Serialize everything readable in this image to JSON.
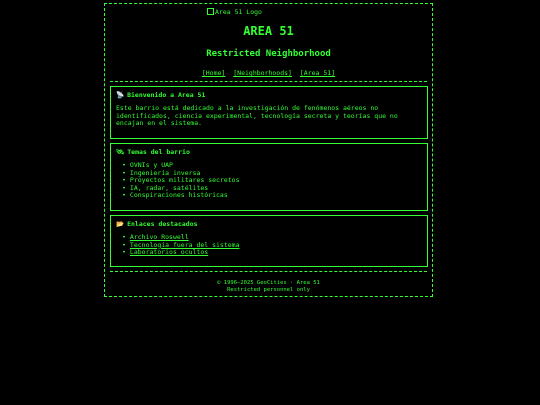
{
  "header": {
    "logo_alt": "Area 51 Logo",
    "title": "AREA 51",
    "subtitle": "Restricted Neighborhood"
  },
  "nav": {
    "links": [
      "[Home]",
      "[Neighborhoods]",
      "[Area 51]"
    ]
  },
  "welcome": {
    "icon": "satellite-dish-icon",
    "glyph": "📡",
    "heading": "Bienvenido a Area 51",
    "text": "Este barrio está dedicado a la investigación de fenómenos aéreos no identificados, ciencia experimental, tecnología secreta y teorías que no encajan en el sistema."
  },
  "topics": {
    "icon": "satellite-icon",
    "glyph": "🛰",
    "heading": "Temas del barrio",
    "items": [
      "OVNIs y UAP",
      "Ingeniería inversa",
      "Proyectos militares secretos",
      "IA, radar, satélites",
      "Conspiraciones históricas"
    ]
  },
  "links": {
    "icon": "open-folder-icon",
    "glyph": "📂",
    "heading": "Enlaces destacados",
    "items": [
      "Archivo Roswell",
      "Tecnología fuera del sistema",
      "Laboratorios ocultos"
    ]
  },
  "footer": {
    "copyright": "© 1996–2025 GeoCities · Area 51",
    "note": "Restricted personnel only"
  },
  "colors": {
    "background": "#000000",
    "accent": "#33ff33"
  }
}
